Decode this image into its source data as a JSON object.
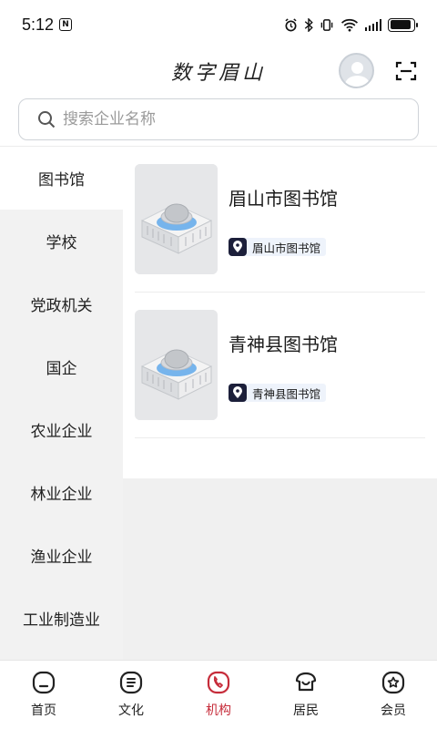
{
  "status_bar": {
    "time": "5:12",
    "nfc_label": "N",
    "battery_level": 0.9
  },
  "header": {
    "title": "数字眉山",
    "avatar_icon": "user-avatar-icon",
    "scan_icon": "scan-icon"
  },
  "search": {
    "placeholder": "搜索企业名称"
  },
  "sidebar": {
    "items": [
      {
        "label": "图书馆",
        "active": true
      },
      {
        "label": "学校"
      },
      {
        "label": "党政机关"
      },
      {
        "label": "国企"
      },
      {
        "label": "农业企业"
      },
      {
        "label": "林业企业"
      },
      {
        "label": "渔业企业"
      },
      {
        "label": "工业制造业"
      }
    ]
  },
  "list": {
    "items": [
      {
        "title": "眉山市图书馆",
        "tag": "眉山市图书馆"
      },
      {
        "title": "青神县图书馆",
        "tag": "青神县图书馆"
      }
    ]
  },
  "bottom_nav": {
    "items": [
      {
        "label": "首页",
        "icon": "home-icon"
      },
      {
        "label": "文化",
        "icon": "culture-icon"
      },
      {
        "label": "机构",
        "icon": "institution-icon",
        "active": true
      },
      {
        "label": "居民",
        "icon": "residents-icon"
      },
      {
        "label": "会员",
        "icon": "member-icon"
      }
    ]
  },
  "colors": {
    "accent": "#c62c3a",
    "sidebar_bg": "#f2f2f2",
    "tag_bg": "#eef3fb"
  }
}
